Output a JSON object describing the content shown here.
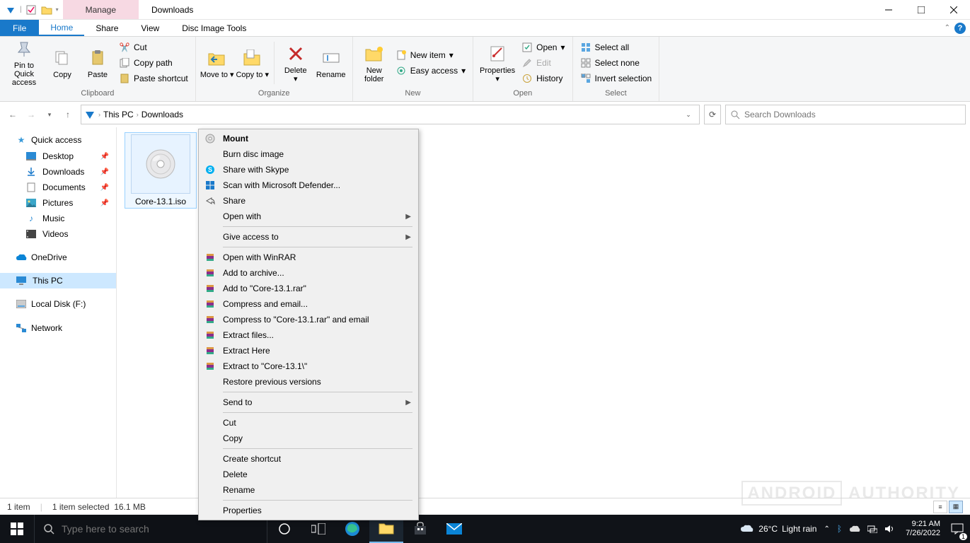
{
  "window": {
    "title": "Downloads",
    "manage_tab": "Manage"
  },
  "tabs": {
    "file": "File",
    "home": "Home",
    "share": "Share",
    "view": "View",
    "context": "Disc Image Tools"
  },
  "ribbon": {
    "clipboard": {
      "label": "Clipboard",
      "pin": "Pin to Quick access",
      "copy": "Copy",
      "paste": "Paste",
      "cut": "Cut",
      "copy_path": "Copy path",
      "paste_shortcut": "Paste shortcut"
    },
    "organize": {
      "label": "Organize",
      "move_to": "Move to",
      "copy_to": "Copy to",
      "delete": "Delete",
      "rename": "Rename"
    },
    "new": {
      "label": "New",
      "new_folder": "New folder",
      "new_item": "New item",
      "easy_access": "Easy access"
    },
    "open": {
      "label": "Open",
      "properties": "Properties",
      "open": "Open",
      "edit": "Edit",
      "history": "History"
    },
    "select": {
      "label": "Select",
      "select_all": "Select all",
      "select_none": "Select none",
      "invert": "Invert selection"
    }
  },
  "breadcrumbs": {
    "root": "This PC",
    "folder": "Downloads"
  },
  "search": {
    "placeholder": "Search Downloads"
  },
  "sidebar": {
    "quick_access": "Quick access",
    "desktop": "Desktop",
    "downloads": "Downloads",
    "documents": "Documents",
    "pictures": "Pictures",
    "music": "Music",
    "videos": "Videos",
    "onedrive": "OneDrive",
    "this_pc": "This PC",
    "local_disk": "Local Disk (F:)",
    "network": "Network"
  },
  "file": {
    "name": "Core-13.1.iso"
  },
  "context_menu": {
    "mount": "Mount",
    "burn": "Burn disc image",
    "skype": "Share with Skype",
    "defender": "Scan with Microsoft Defender...",
    "share": "Share",
    "open_with": "Open with",
    "give_access": "Give access to",
    "winrar_open": "Open with WinRAR",
    "add_archive": "Add to archive...",
    "add_rar": "Add to \"Core-13.1.rar\"",
    "comp_email": "Compress and email...",
    "comp_rar_email": "Compress to \"Core-13.1.rar\" and email",
    "extract_files": "Extract files...",
    "extract_here": "Extract Here",
    "extract_to": "Extract to \"Core-13.1\\\"",
    "restore": "Restore previous versions",
    "send_to": "Send to",
    "cut": "Cut",
    "copy": "Copy",
    "create_shortcut": "Create shortcut",
    "delete": "Delete",
    "rename": "Rename",
    "properties": "Properties"
  },
  "status": {
    "count": "1 item",
    "selected": "1 item selected",
    "size": "16.1 MB"
  },
  "taskbar": {
    "search_placeholder": "Type here to search",
    "weather_temp": "26°C",
    "weather_text": "Light rain",
    "time": "9:21 AM",
    "date": "7/26/2022",
    "notif_count": "1"
  },
  "watermark": {
    "a": "ANDROID",
    "b": "AUTHORITY"
  }
}
